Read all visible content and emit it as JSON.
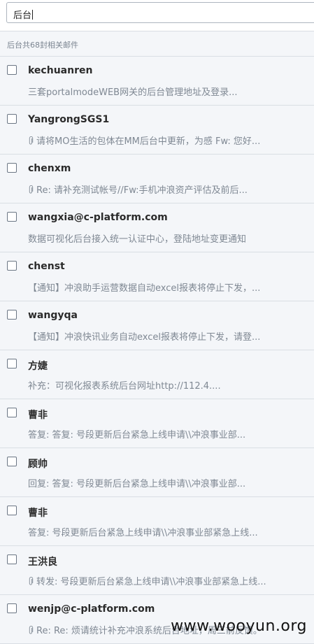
{
  "search": {
    "value": "后台"
  },
  "result_count": "后台共68封相关邮件",
  "emails": [
    {
      "sender": "kechuanren",
      "subject": "三套portalmodeWEB网关的后台管理地址及登录...",
      "attachment": false
    },
    {
      "sender": "YangrongSGS1",
      "subject": "请将MO生活的包体在MM后台中更新，为感 Fw: 您好...",
      "attachment": true
    },
    {
      "sender": "chenxm",
      "subject": "Re: 请补充测试帐号//Fw:手机冲浪资产评估及前后...",
      "attachment": true
    },
    {
      "sender": "wangxia@c-platform.com",
      "subject": "数据可视化后台接入统一认证中心，登陆地址变更通知",
      "attachment": false
    },
    {
      "sender": "chenst",
      "subject": "【通知】冲浪助手运营数据自动excel报表将停止下发，...",
      "attachment": false
    },
    {
      "sender": "wangyqa",
      "subject": "【通知】冲浪快讯业务自动excel报表将停止下发，请登...",
      "attachment": false
    },
    {
      "sender": "方婕",
      "subject": "补充：可视化报表系统后台网址http://112.4....",
      "attachment": false
    },
    {
      "sender": "曹非",
      "subject": "答复: 答复: 号段更新后台紧急上线申请\\\\冲浪事业部...",
      "attachment": false
    },
    {
      "sender": "顾帅",
      "subject": "回复: 答复: 号段更新后台紧急上线申请\\\\冲浪事业部...",
      "attachment": false
    },
    {
      "sender": "曹非",
      "subject": "答复: 号段更新后台紧急上线申请\\\\冲浪事业部紧急上线...",
      "attachment": false
    },
    {
      "sender": "王洪良",
      "subject": "转发: 号段更新后台紧急上线申请\\\\冲浪事业部紧急上线...",
      "attachment": true
    },
    {
      "sender": "wenjp@c-platform.com",
      "subject": "Re: Re: 烦请统计补充冲浪系统后台地址，周三前反馈。",
      "attachment": true
    }
  ],
  "watermark": "www.wooyun.org",
  "colors": {
    "background": "#f4f6f9",
    "divider": "#d9dee4",
    "subject_text": "#7f8893"
  },
  "icons": {
    "attachment": "paperclip-icon",
    "checkbox": "checkbox-icon"
  }
}
